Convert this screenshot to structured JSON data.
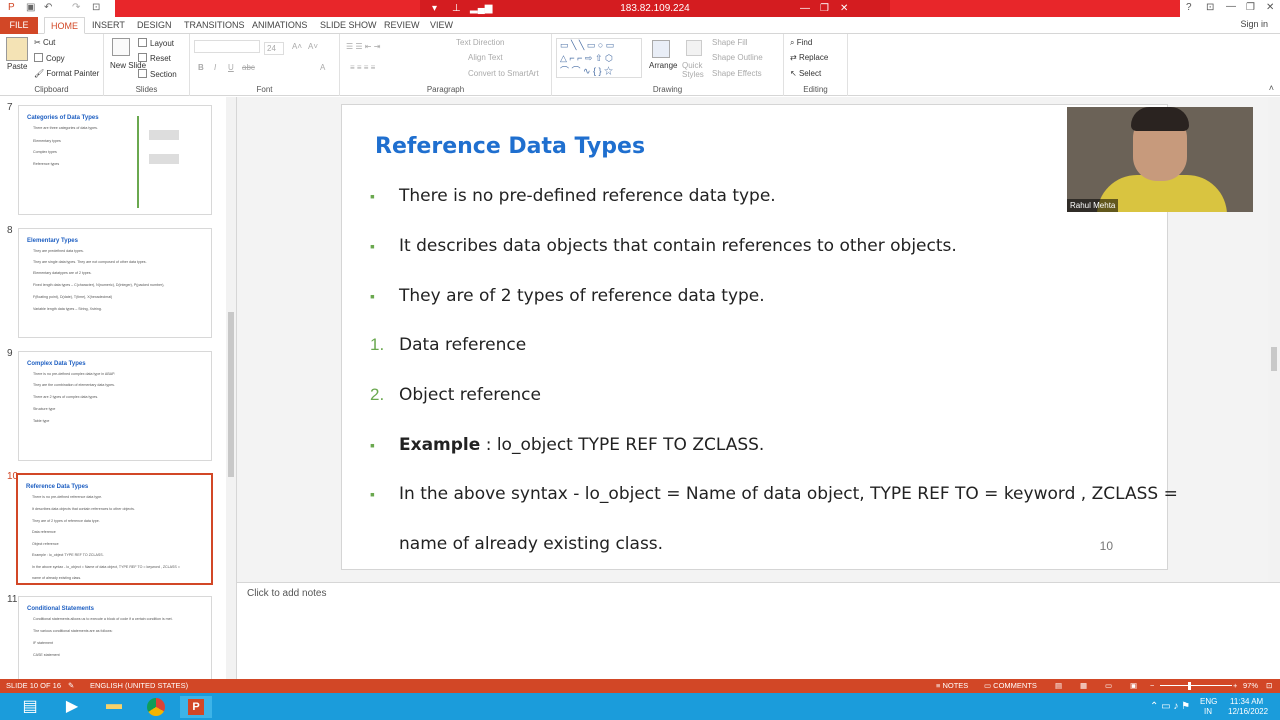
{
  "window": {
    "remote_ip": "183.82.109.224",
    "controls": {
      "help": "?",
      "minimize": "—",
      "restore": "❐",
      "close": "✕"
    },
    "sign_in": "Sign in"
  },
  "ribbon_tabs": [
    "FILE",
    "HOME",
    "INSERT",
    "DESIGN",
    "TRANSITIONS",
    "ANIMATIONS",
    "SLIDE SHOW",
    "REVIEW",
    "VIEW"
  ],
  "ribbon": {
    "clipboard": {
      "label": "Clipboard",
      "paste": "Paste",
      "cut": "Cut",
      "copy": "Copy",
      "format_painter": "Format Painter"
    },
    "slides": {
      "label": "Slides",
      "new_slide": "New Slide",
      "layout": "Layout",
      "reset": "Reset",
      "section": "Section"
    },
    "font": {
      "label": "Font",
      "size": "24",
      "bold": "B",
      "italic": "I",
      "underline": "U",
      "strike": "abc"
    },
    "paragraph": {
      "label": "Paragraph",
      "text_direction": "Text Direction",
      "align_text": "Align Text",
      "convert_smartart": "Convert to SmartArt"
    },
    "drawing": {
      "label": "Drawing",
      "arrange": "Arrange",
      "quick_styles": "Quick Styles",
      "shape_fill": "Shape Fill",
      "shape_outline": "Shape Outline",
      "shape_effects": "Shape Effects"
    },
    "editing": {
      "label": "Editing",
      "find": "Find",
      "replace": "Replace",
      "select": "Select"
    }
  },
  "thumbnails": [
    {
      "num": "7",
      "title": "Categories of Data Types",
      "lines": [
        "There are three categories of data types.",
        "Elementary types",
        "Complex types",
        "Reference types"
      ]
    },
    {
      "num": "8",
      "title": "Elementary Types",
      "lines": [
        "They are predefined data types.",
        "They are single data types. They are not composed of other data types.",
        "Elementary datatypes are of 2 types.",
        "Fixed length data types – C(character), N(numeric), D(integer), P(packed number),",
        "F(floating point), D(date), T(time), X(hexadecimal)",
        "Variable length data types – String, Xstring."
      ]
    },
    {
      "num": "9",
      "title": "Complex Data Types",
      "lines": [
        "There is no pre-defined complex data type in ABAP.",
        "They are the combination of elementary data types.",
        "There are 2 types of complex data types.",
        "Structure type",
        "Table type"
      ]
    },
    {
      "num": "10",
      "title": "Reference Data Types",
      "lines": [
        "There is no pre-defined reference data type.",
        "It describes data objects that contain references to other objects.",
        "They are of 2 types of reference data type.",
        "Data reference",
        "Object reference",
        "Example : lo_object TYPE REF TO ZCLASS.",
        "In the above syntax - lo_object = Name of data object, TYPE REF TO = keyword , ZCLASS =",
        "name of already existing class."
      ]
    },
    {
      "num": "11",
      "title": "Conditional Statements",
      "lines": [
        "Conditional statements allows us to execute a block of code if a certain condition is met.",
        "The various conditional statements are as follows:",
        "IF statement",
        "CASE statement"
      ]
    }
  ],
  "slide": {
    "title": "Reference Data Types",
    "items": [
      {
        "marker": "▪",
        "text": "There is no pre-defined reference data type."
      },
      {
        "marker": "▪",
        "text": "It describes data objects that contain references to other objects."
      },
      {
        "marker": "▪",
        "text": "They are of 2 types of reference data type."
      },
      {
        "marker": "1.",
        "text": "Data reference"
      },
      {
        "marker": "2.",
        "text": "Object reference"
      },
      {
        "marker": "▪",
        "bold": "Example",
        "text": " : lo_object TYPE REF TO ZCLASS."
      },
      {
        "marker": "▪",
        "text": "In the above syntax - lo_object = Name of data object, TYPE REF TO = keyword , ZCLASS ="
      },
      {
        "marker": "",
        "text": "name of already existing class."
      }
    ],
    "page_number": "10"
  },
  "video": {
    "name": "Rahul Mehta"
  },
  "notes_placeholder": "Click to add notes",
  "status": {
    "slide": "SLIDE 10 OF 16",
    "language": "ENGLISH (UNITED STATES)",
    "notes": "NOTES",
    "comments": "COMMENTS",
    "zoom": "97%"
  },
  "taskbar": {
    "lang": "ENG",
    "region": "IN",
    "time": "11:34 AM",
    "date": "12/16/2022"
  },
  "colors": {
    "accent": "#d24726",
    "title_blue": "#1f6fcf",
    "bullet_green": "#6aa84f",
    "taskbar": "#1b9cdb"
  }
}
